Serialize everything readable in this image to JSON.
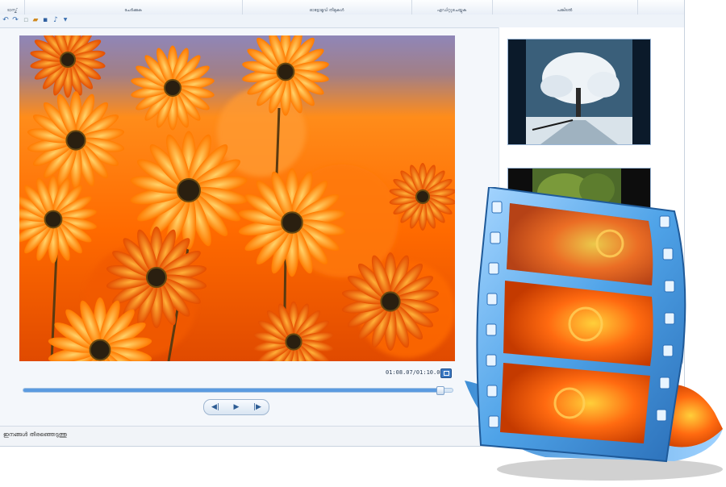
{
  "ribbon": {
    "groups": [
      {
        "label": "ടാസ്ക്"
      },
      {
        "label": "ചേർക്കുക"
      },
      {
        "label": "ഓട്ടോമൂവി തീമുകൾ"
      },
      {
        "label": "എഡിറ്റുചെയ്യുക"
      },
      {
        "label": "പങ്കിടൽ"
      }
    ]
  },
  "quick_access": {
    "icons": [
      "undo-icon",
      "redo-icon",
      "new-icon",
      "open-icon",
      "save-icon",
      "music-icon",
      "dropdown-icon"
    ]
  },
  "preview": {
    "time_readout": "01:08.07/01:10.00",
    "progress_fraction": 0.97
  },
  "transport": {
    "previous_symbol": "◀|",
    "play_symbol": "▶",
    "next_symbol": "|▶"
  },
  "status_bar": {
    "text": "ഇനങ്ങൾ തിരഞ്ഞെടുത്തു"
  },
  "storyboard": {
    "items": [
      {
        "kind": "snowy-tree-photo"
      },
      {
        "kind": "green-garden-photo"
      }
    ]
  },
  "colors": {
    "accent": "#3a78c2",
    "flower_orange": "#ff8a00",
    "film_blue": "#4fa3e8"
  }
}
